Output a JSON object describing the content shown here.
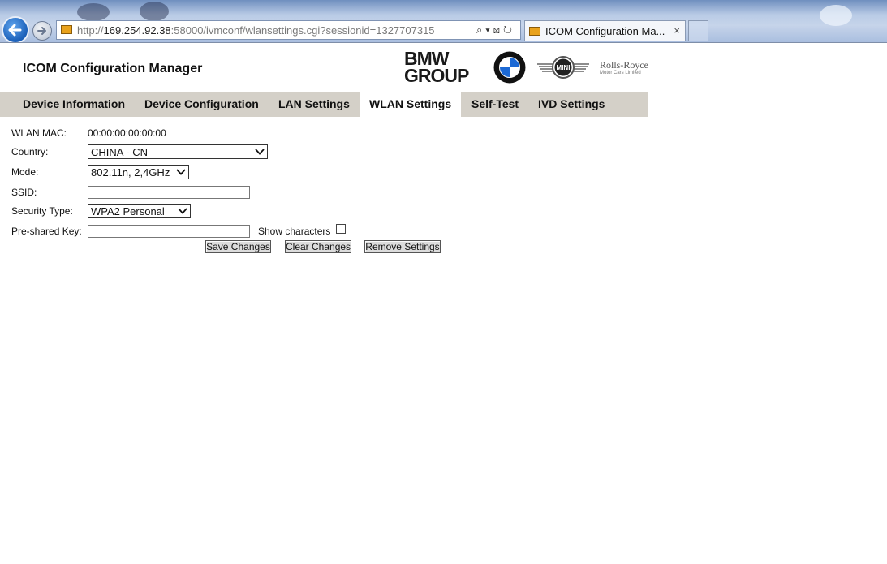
{
  "browser": {
    "url_prefix": "http://",
    "url_host": "169.254.92.38",
    "url_rest": ":58000/ivmconf/wlansettings.cgi?sessionid=1327707315",
    "tab_title": "ICOM Configuration Ma...",
    "tab_close": "×",
    "address_tools": "⌕▾⊠↻"
  },
  "header": {
    "title": "ICOM Configuration Manager",
    "logos": {
      "bmw_group_line1": "BMW",
      "bmw_group_line2": "GROUP",
      "mini": "MINI",
      "rolls_royce_line1": "Rolls-Royce",
      "rolls_royce_line2": "Motor Cars Limited"
    }
  },
  "nav": {
    "tabs": [
      {
        "label": "Device Information"
      },
      {
        "label": "Device Configuration"
      },
      {
        "label": "LAN Settings"
      },
      {
        "label": "WLAN Settings",
        "active": true
      },
      {
        "label": "Self-Test"
      },
      {
        "label": "IVD Settings"
      }
    ]
  },
  "form": {
    "wlan_mac_label": "WLAN MAC:",
    "wlan_mac_value": "00:00:00:00:00:00",
    "country_label": "Country:",
    "country_value": "CHINA - CN",
    "mode_label": "Mode:",
    "mode_value": "802.11n, 2,4GHz",
    "ssid_label": "SSID:",
    "ssid_value": "",
    "security_label": "Security Type:",
    "security_value": "WPA2 Personal",
    "psk_label": "Pre-shared Key:",
    "psk_value": "",
    "show_characters_label": "Show characters",
    "show_characters_checked": false
  },
  "buttons": {
    "save": "Save Changes",
    "clear": "Clear Changes",
    "remove": "Remove Settings"
  }
}
